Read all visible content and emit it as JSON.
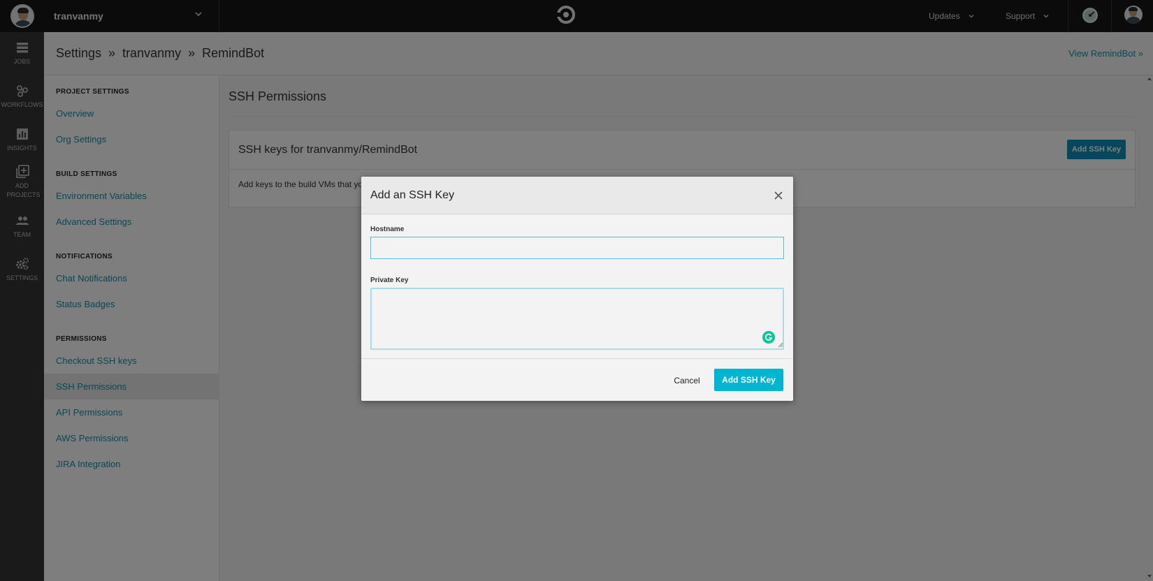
{
  "topbar": {
    "org_name": "tranvanmy",
    "nav": [
      {
        "label": "Updates"
      },
      {
        "label": "Support"
      }
    ]
  },
  "rail": {
    "items": [
      {
        "label": "JOBS",
        "icon": "jobs-icon"
      },
      {
        "label": "WORKFLOWS",
        "icon": "workflows-icon"
      },
      {
        "label": "INSIGHTS",
        "icon": "insights-icon"
      },
      {
        "label": "ADD PROJECTS",
        "icon": "add-projects-icon"
      },
      {
        "label": "TEAM",
        "icon": "team-icon"
      },
      {
        "label": "SETTINGS",
        "icon": "settings-icon"
      }
    ]
  },
  "header": {
    "crumbs": [
      "Settings",
      "tranvanmy",
      "RemindBot"
    ],
    "separator": "»",
    "view_link": "View RemindBot »"
  },
  "settings_nav": {
    "sections": [
      {
        "title": "PROJECT SETTINGS",
        "items": [
          "Overview",
          "Org Settings"
        ]
      },
      {
        "title": "BUILD SETTINGS",
        "items": [
          "Environment Variables",
          "Advanced Settings"
        ]
      },
      {
        "title": "NOTIFICATIONS",
        "items": [
          "Chat Notifications",
          "Status Badges"
        ]
      },
      {
        "title": "PERMISSIONS",
        "items": [
          "Checkout SSH keys",
          "SSH Permissions",
          "API Permissions",
          "AWS Permissions",
          "JIRA Integration"
        ]
      }
    ],
    "active": "SSH Permissions"
  },
  "main": {
    "title": "SSH Permissions",
    "card_title": "SSH keys for tranvanmy/RemindBot",
    "card_button": "Add SSH Key",
    "card_body": "Add keys to the build VMs that yo"
  },
  "modal": {
    "title": "Add an SSH Key",
    "hostname_label": "Hostname",
    "hostname_value": "",
    "private_key_label": "Private Key",
    "private_key_value": "",
    "cancel_label": "Cancel",
    "submit_label": "Add SSH Key"
  },
  "colors": {
    "accent": "#00b5d1",
    "link": "#138fa8",
    "topbar": "#161616",
    "rail": "#353535"
  }
}
